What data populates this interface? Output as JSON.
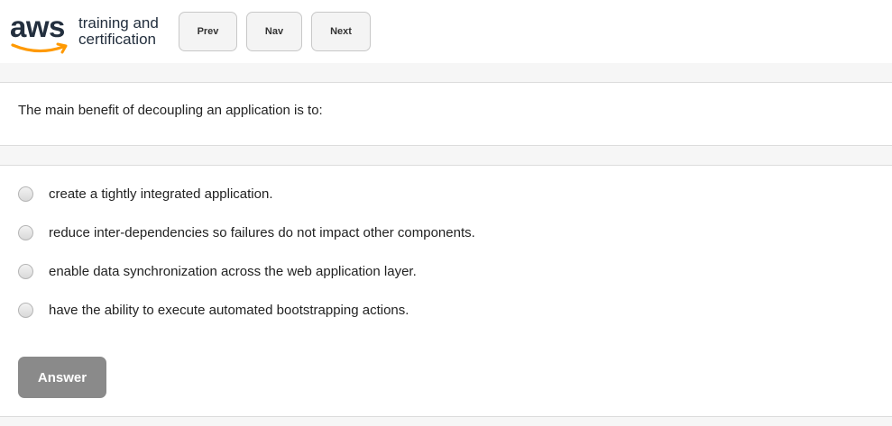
{
  "logo": {
    "brand": "aws",
    "tagline_line1": "training and",
    "tagline_line2": "certification",
    "accent_color": "#ff9900",
    "text_color": "#232f3e"
  },
  "toolbar": {
    "prev_label": "Prev",
    "nav_label": "Nav",
    "next_label": "Next"
  },
  "question": {
    "text": "The main benefit of decoupling an application is to:"
  },
  "options": [
    {
      "label": "create a tightly integrated application."
    },
    {
      "label": "reduce inter-dependencies so failures do not impact other components."
    },
    {
      "label": "enable data synchronization across the web application layer."
    },
    {
      "label": "have the ability to execute automated bootstrapping actions."
    }
  ],
  "answer_button": {
    "label": "Answer",
    "color": "#8a8a8a"
  }
}
